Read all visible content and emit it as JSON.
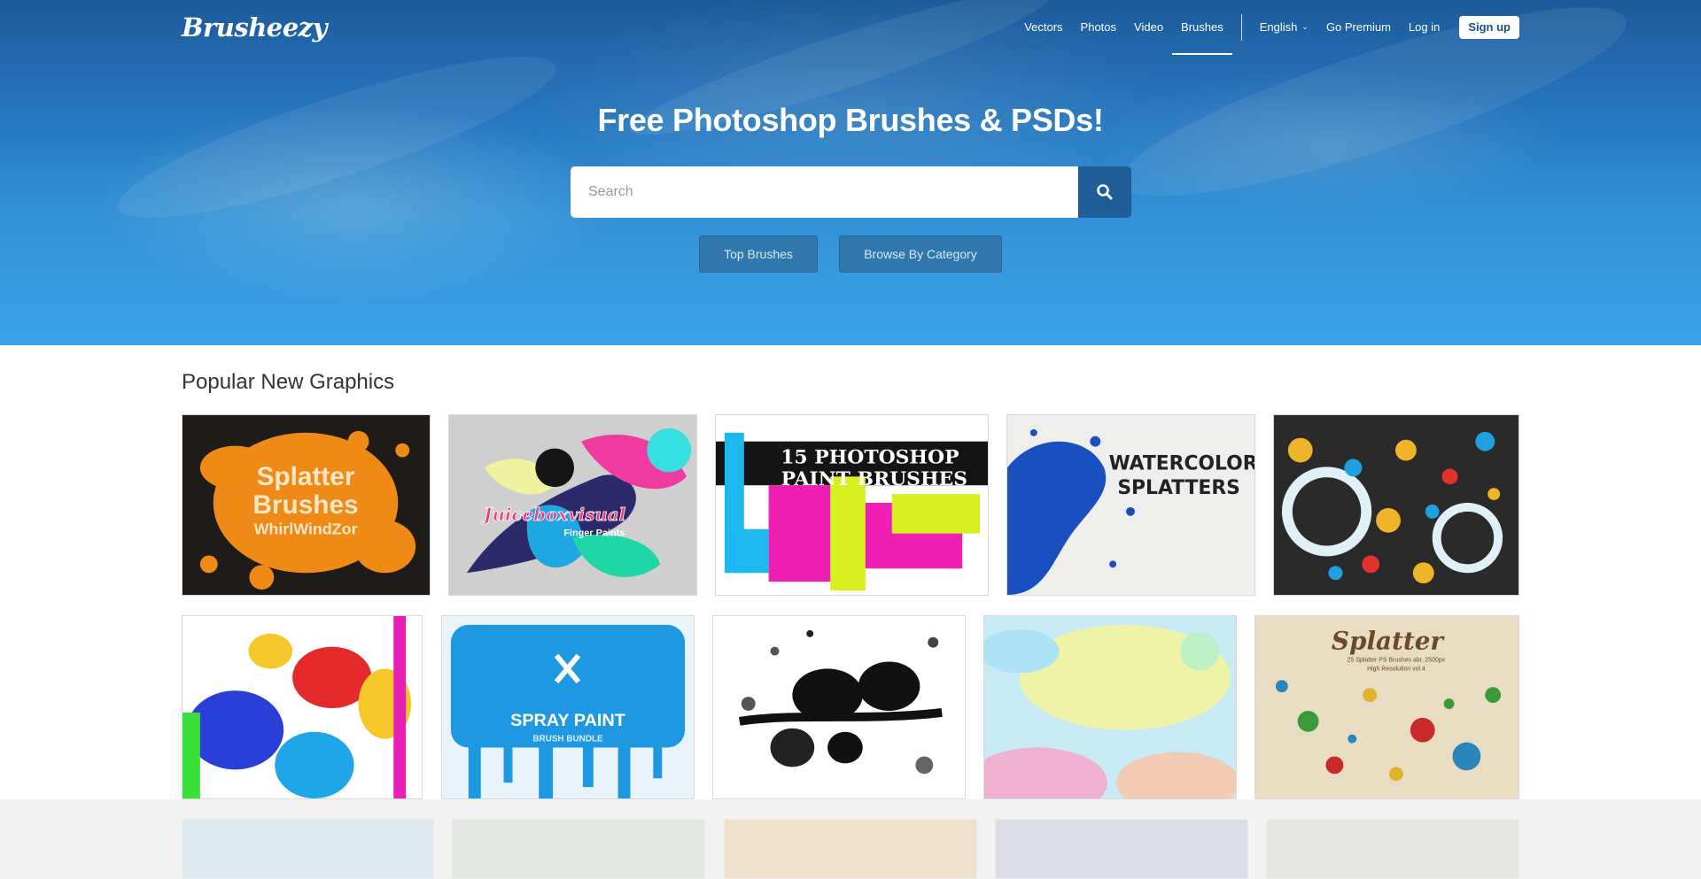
{
  "header": {
    "logo": "Brusheezy",
    "nav": [
      {
        "label": "Vectors"
      },
      {
        "label": "Photos"
      },
      {
        "label": "Video"
      },
      {
        "label": "Brushes"
      }
    ],
    "language": "English",
    "go_premium": "Go Premium",
    "login": "Log in",
    "signup": "Sign up"
  },
  "hero": {
    "title": "Free Photoshop Brushes & PSDs!",
    "search_placeholder": "Search",
    "buttons": [
      "Top Brushes",
      "Browse By Category"
    ]
  },
  "section": {
    "title": "Popular New Graphics"
  },
  "tiles": {
    "t1": {
      "line1": "Splatter",
      "line2": "Brushes",
      "line3": "WhirlWindZor"
    },
    "t2": {
      "line1": "Juiceboxvisual",
      "line2": "Finger Paints"
    },
    "t3": {
      "line1": "15 PHOTOSHOP",
      "line2": "PAINT BRUSHES"
    },
    "t4": {
      "line1": "WATERCOLOR",
      "line2": "SPLATTERS"
    },
    "t7": {
      "line1": "SPRAY PAINT",
      "line2": "BRUSH BUNDLE"
    },
    "t10": {
      "line1": "Splatter",
      "line2": "25 Splatter PS Brushes abr. 2500px",
      "line3": "High Resolution vol.4"
    }
  },
  "colors": {
    "accent": "#1f5d99",
    "hero_bottom": "#3aa3e6",
    "signup_text": "#1d4f86"
  }
}
